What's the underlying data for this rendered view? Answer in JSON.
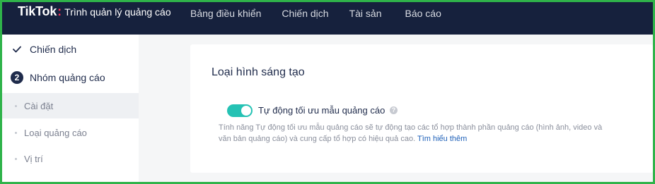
{
  "header": {
    "logo_text": "TikTok",
    "logo_subtitle": "Trình quản lý quảng cáo",
    "nav": [
      {
        "label": "Bảng điều khiển"
      },
      {
        "label": "Chiến dịch"
      },
      {
        "label": "Tài sản"
      },
      {
        "label": "Báo cáo"
      }
    ]
  },
  "sidebar": {
    "steps": [
      {
        "label": "Chiến dịch",
        "state": "completed"
      },
      {
        "label": "Nhóm quảng cáo",
        "number": "2",
        "state": "current"
      }
    ],
    "sub_items": [
      {
        "label": "Cài đặt",
        "active": true
      },
      {
        "label": "Loại quảng cáo"
      },
      {
        "label": "Vị trí"
      }
    ]
  },
  "main": {
    "section_title": "Loại hình sáng tạo",
    "toggle": {
      "label": "Tự động tối ưu mẫu quảng cáo",
      "on": true
    },
    "description": "Tính năng Tự động tối ưu mẫu quảng cáo sẽ tự động tạo các tổ hợp thành phần quảng cáo (hình ảnh, video và văn bản quảng cáo) và cung cấp tổ hợp có hiệu quả cao.",
    "learn_more": "Tìm hiểu thêm"
  },
  "colors": {
    "topbar": "#16213d",
    "accent_toggle": "#25c2b4",
    "link": "#1e60b8",
    "frame_border": "#2fb34a"
  }
}
